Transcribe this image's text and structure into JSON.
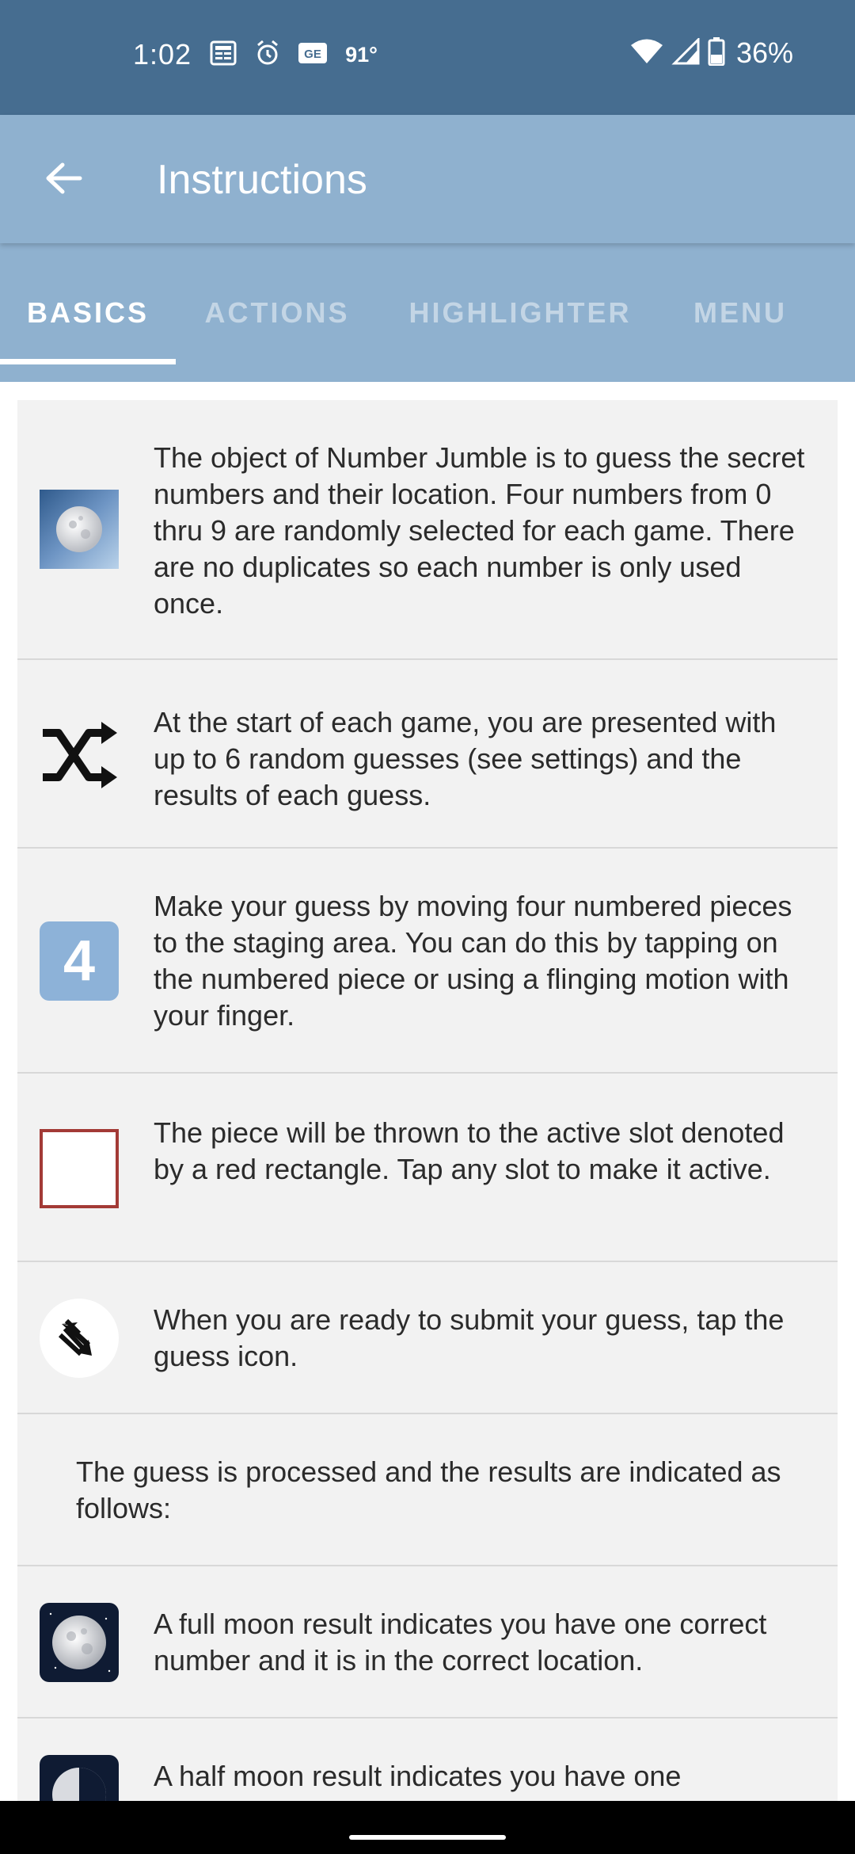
{
  "status_bar": {
    "time": "1:02",
    "temperature": "91°",
    "battery": "36%",
    "icons": [
      "news-icon",
      "alarm-icon",
      "ge-icon",
      "wifi-icon",
      "signal-icon",
      "battery-icon"
    ]
  },
  "app_bar": {
    "title": "Instructions",
    "back_icon": "arrow-left-icon"
  },
  "tabs": [
    {
      "label": "BASICS",
      "active": true
    },
    {
      "label": "ACTIONS",
      "active": false
    },
    {
      "label": "HIGHLIGHTER",
      "active": false
    },
    {
      "label": "MENU",
      "active": false
    }
  ],
  "instructions": [
    {
      "icon": "moon-tile-icon",
      "text": "The object of Number Jumble is to guess the secret numbers and their location. Four numbers from 0 thru 9 are randomly selected for each game. There are no duplicates so each number is only used once."
    },
    {
      "icon": "shuffle-icon",
      "text": "At the start of each game, you are presented with up to 6 random guesses (see settings) and the results of each guess."
    },
    {
      "icon": "number-four-tile-icon",
      "tile_number": "4",
      "text": "Make your guess by moving four numbered pieces to the staging area. You can do this by tapping on the numbered piece or using a flinging motion with your finger."
    },
    {
      "icon": "red-rectangle-slot-icon",
      "text": "The piece will be thrown to the active slot denoted by a red rectangle. Tap any slot to make it active."
    },
    {
      "icon": "guess-chevrons-icon",
      "text": "When you are ready to submit your guess, tap the guess icon."
    },
    {
      "icon": "",
      "text": "The guess is processed and the results are indicated as follows:"
    },
    {
      "icon": "full-moon-icon",
      "text": "A full moon result indicates you have one correct number and it is in the correct location."
    },
    {
      "icon": "half-moon-icon",
      "text": "A half moon result indicates you have one"
    }
  ],
  "colors": {
    "status_bar": "#466d90",
    "app_bar": "#8fb1cf",
    "tab_inactive": "#c3d5e5",
    "content_bg": "#f2f2f2",
    "tile_blue": "#8db2d8",
    "slot_red": "#a33a36"
  }
}
